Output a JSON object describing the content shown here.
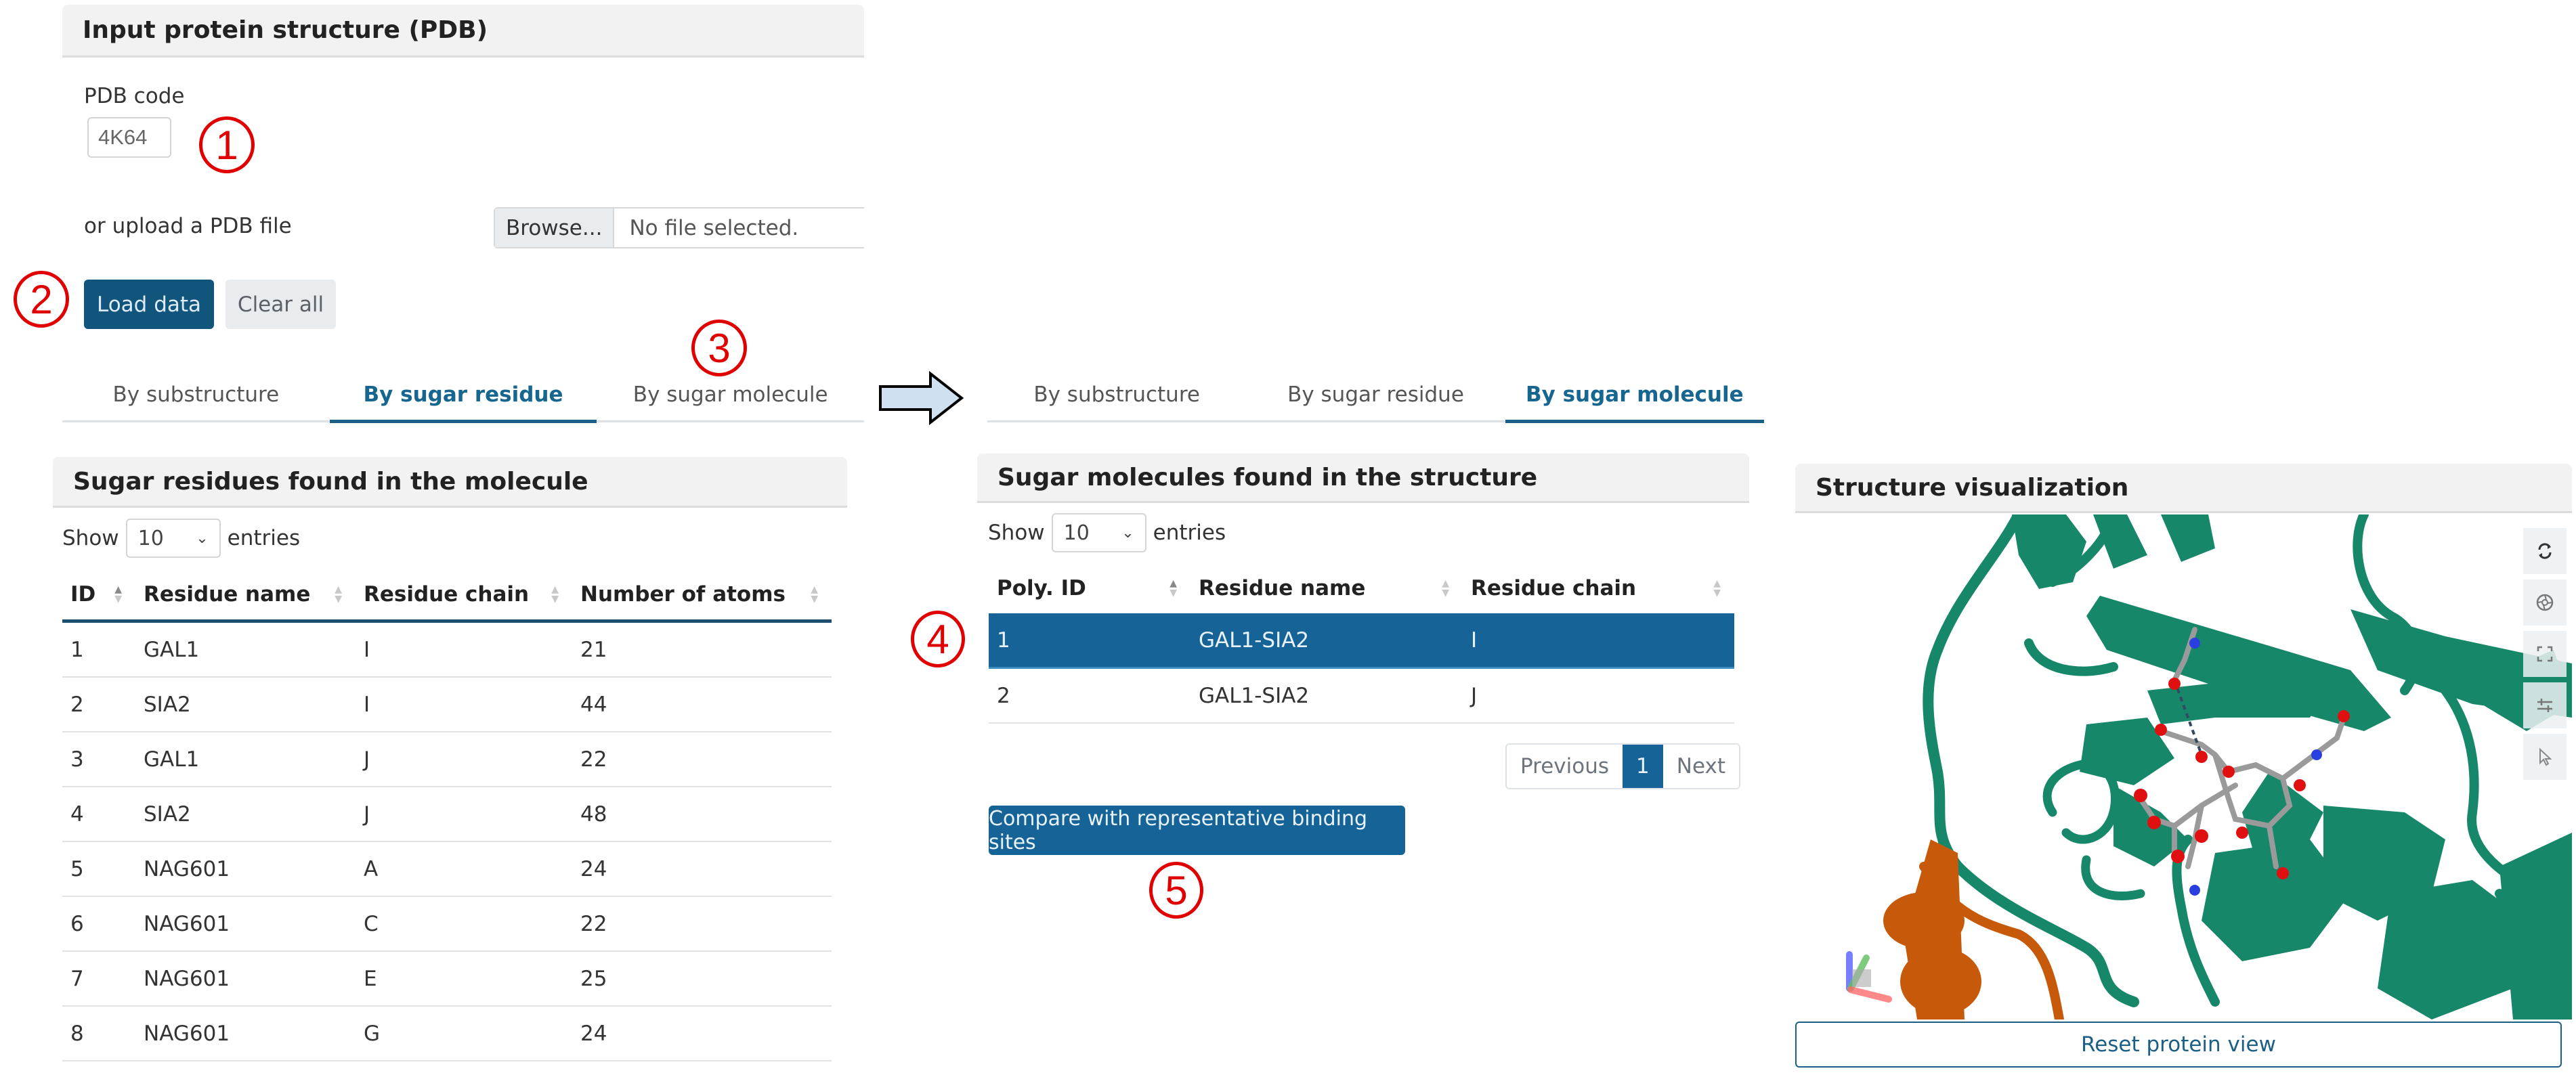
{
  "input_panel": {
    "title": "Input protein structure (PDB)",
    "pdb_code_label": "PDB code",
    "pdb_code_value": "4K64",
    "upload_label": "or upload a PDB file",
    "browse_label": "Browse...",
    "file_status": "No file selected.",
    "load_button": "Load data",
    "clear_button": "Clear all"
  },
  "annotations": [
    "1",
    "2",
    "3",
    "4",
    "5"
  ],
  "tabs_before": {
    "items": [
      "By substructure",
      "By sugar residue",
      "By sugar molecule"
    ],
    "active": "By sugar residue"
  },
  "tabs_after": {
    "items": [
      "By substructure",
      "By sugar residue",
      "By sugar molecule"
    ],
    "active": "By sugar molecule"
  },
  "residues_panel": {
    "title": "Sugar residues found in the molecule",
    "show_label": "Show",
    "entries_value": "10",
    "entries_label": "entries",
    "columns": [
      "ID",
      "Residue name",
      "Residue chain",
      "Number of atoms"
    ],
    "rows": [
      [
        "1",
        "GAL1",
        "I",
        "21"
      ],
      [
        "2",
        "SIA2",
        "I",
        "44"
      ],
      [
        "3",
        "GAL1",
        "J",
        "22"
      ],
      [
        "4",
        "SIA2",
        "J",
        "48"
      ],
      [
        "5",
        "NAG601",
        "A",
        "24"
      ],
      [
        "6",
        "NAG601",
        "C",
        "22"
      ],
      [
        "7",
        "NAG601",
        "E",
        "25"
      ],
      [
        "8",
        "NAG601",
        "G",
        "24"
      ]
    ]
  },
  "molecules_panel": {
    "title": "Sugar molecules found in the structure",
    "show_label": "Show",
    "entries_value": "10",
    "entries_label": "entries",
    "columns": [
      "Poly. ID",
      "Residue name",
      "Residue chain"
    ],
    "rows": [
      [
        "1",
        "GAL1-SIA2",
        "I"
      ],
      [
        "2",
        "GAL1-SIA2",
        "J"
      ]
    ],
    "selected_row": 0,
    "pagination": {
      "previous": "Previous",
      "current": "1",
      "next": "Next"
    },
    "compare_button": "Compare with representative binding sites"
  },
  "structure_panel": {
    "title": "Structure visualization",
    "toolbar": [
      "spin-icon",
      "screenshot-icon",
      "fullscreen-icon",
      "settings-icon",
      "select-pointer-icon"
    ],
    "reset_button": "Reset protein view",
    "colors": {
      "chain_main": "#17876a",
      "chain_secondary": "#c75a0a",
      "oxygen": "#e01010",
      "nitrogen": "#2a3fe0",
      "carbon": "#9a9a9a"
    }
  },
  "colors": {
    "primary": "#11557c",
    "selected_row": "#166497",
    "annotation": "#e00000",
    "arrow_fill": "#cfe0f1"
  }
}
